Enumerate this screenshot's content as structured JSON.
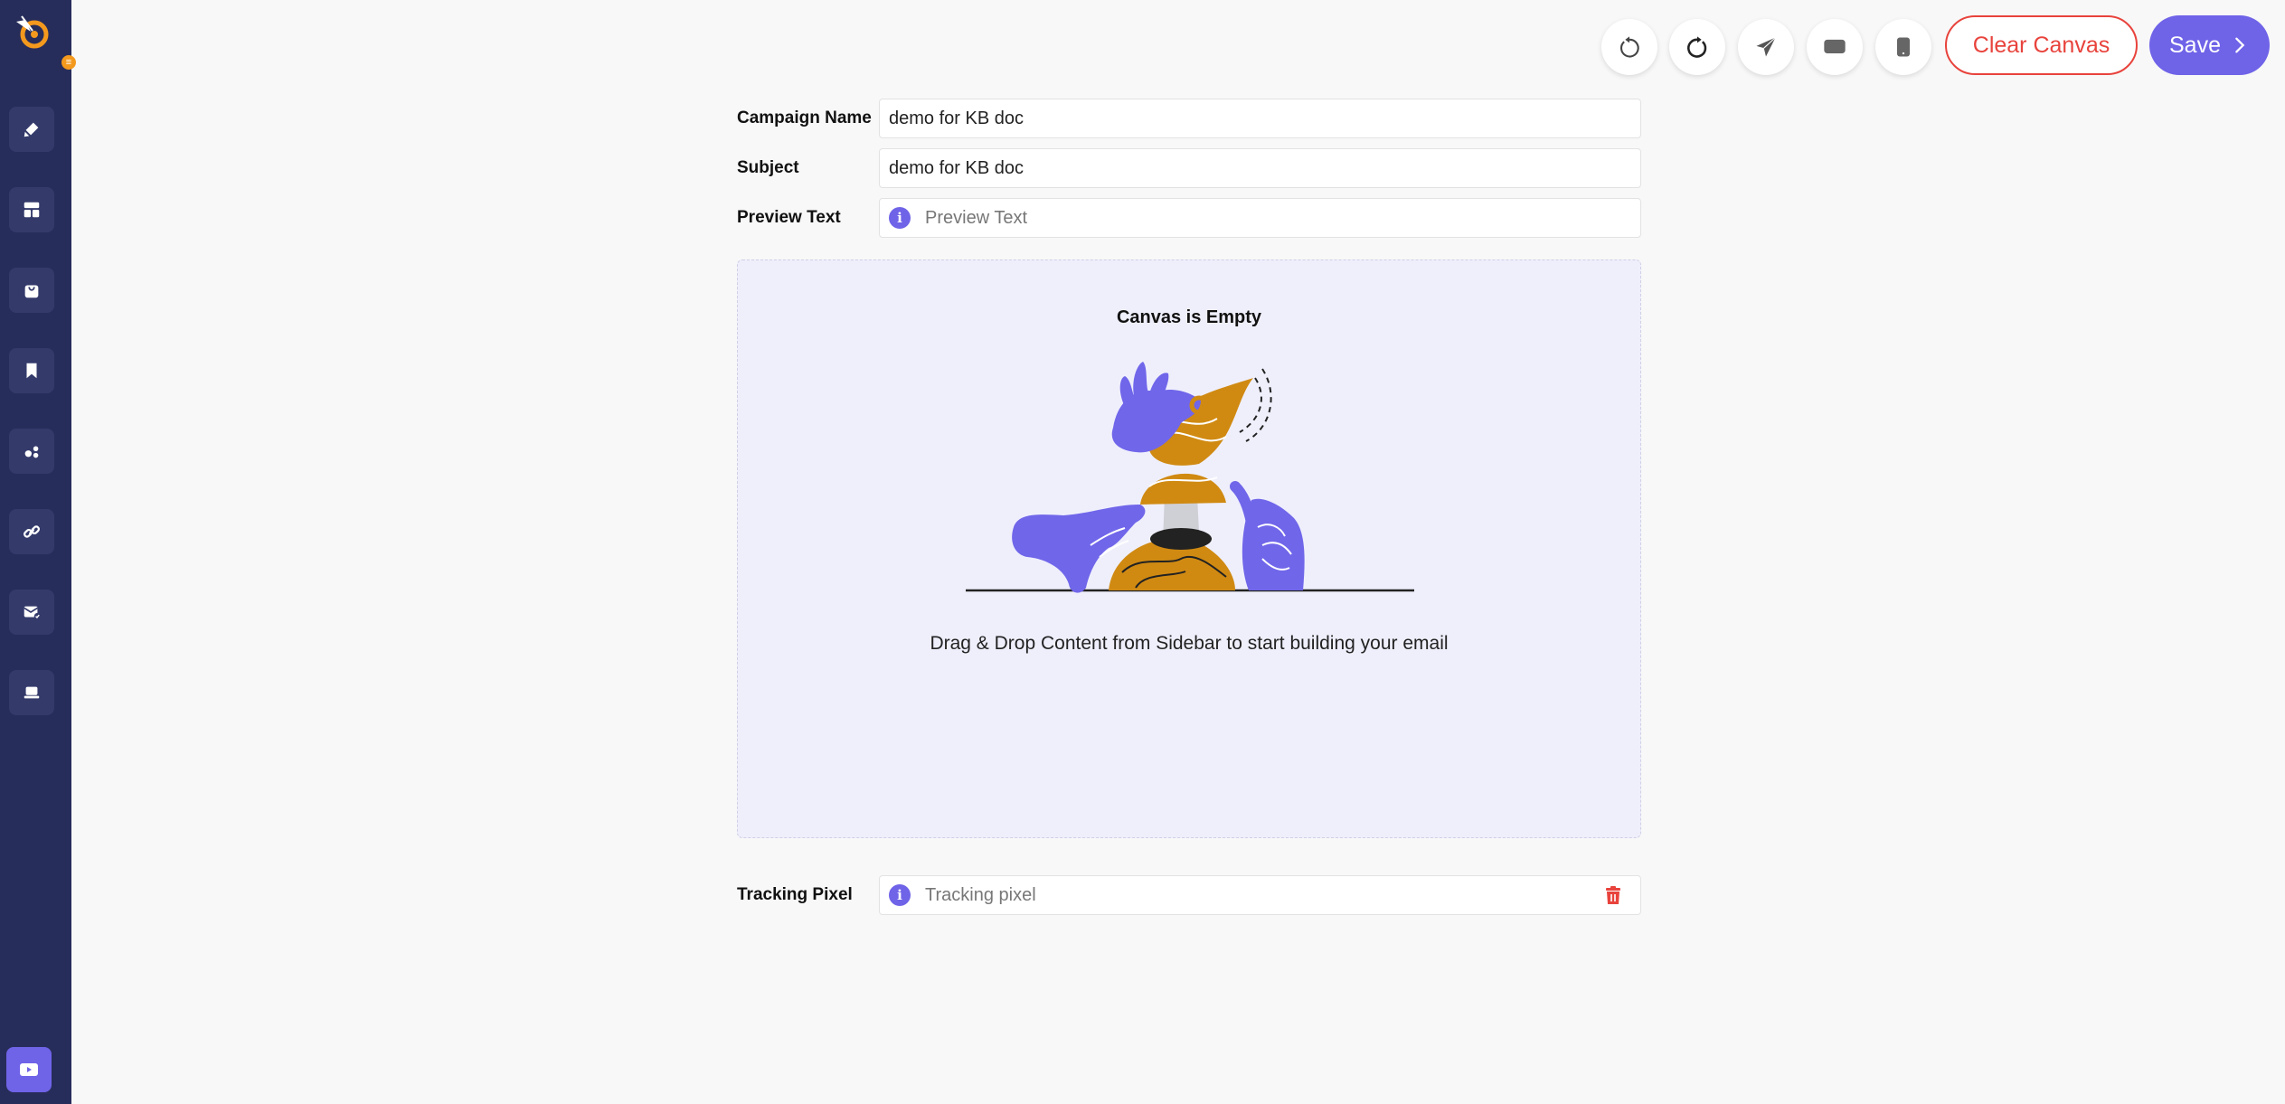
{
  "sidebar": {
    "logo_badge": "≡",
    "items": [
      {
        "icon": "brush-icon",
        "label": "Design"
      },
      {
        "icon": "layout-icon",
        "label": "Layout"
      },
      {
        "icon": "bag-icon",
        "label": "Products"
      },
      {
        "icon": "bookmark-icon",
        "label": "Saved"
      },
      {
        "icon": "blocks-icon",
        "label": "Elements"
      },
      {
        "icon": "link-icon",
        "label": "Links"
      },
      {
        "icon": "email-check-icon",
        "label": "Email"
      },
      {
        "icon": "footer-icon",
        "label": "Footer"
      }
    ],
    "video_icon": "video-play-icon"
  },
  "toolbar": {
    "undo_icon": "undo-icon",
    "redo_icon": "redo-icon",
    "send_icon": "send-icon",
    "desktop_icon": "desktop-icon",
    "mobile_icon": "mobile-icon",
    "clear_label": "Clear Canvas",
    "save_label": "Save",
    "accent": "#6f63e8",
    "danger": "#e8433c"
  },
  "form": {
    "campaign_name_label": "Campaign Name",
    "campaign_name_value": "demo for KB doc",
    "subject_label": "Subject",
    "subject_value": "demo for KB doc",
    "preview_text_label": "Preview Text",
    "preview_text_placeholder": "Preview Text",
    "tracking_pixel_label": "Tracking Pixel",
    "tracking_pixel_placeholder": "Tracking pixel"
  },
  "canvas": {
    "title": "Canvas is Empty",
    "hint": "Drag & Drop Content from Sidebar to start building your email"
  }
}
